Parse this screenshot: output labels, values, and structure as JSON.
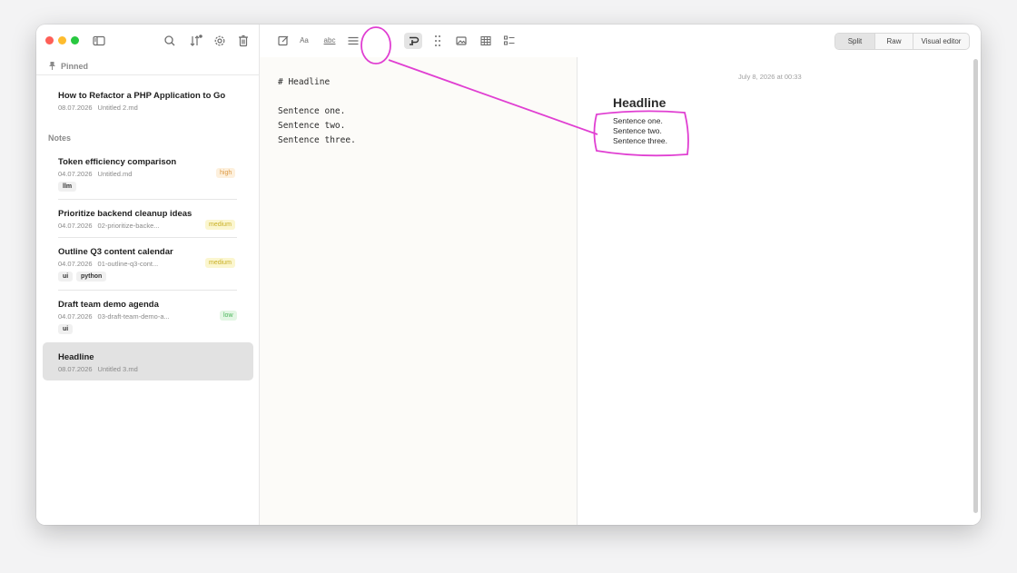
{
  "window": {
    "title": ""
  },
  "sidebar": {
    "pinned_label": "Pinned",
    "notes_label": "Notes",
    "pinned": [
      {
        "title": "How to Refactor a PHP Application to Go",
        "date": "08.07.2026",
        "file": "Untitled 2.md"
      }
    ],
    "notes": [
      {
        "title": "Token efficiency comparison",
        "date": "04.07.2026",
        "file": "Untitled.md",
        "priority": "high",
        "tags": [
          "llm"
        ]
      },
      {
        "title": "Prioritize backend cleanup ideas",
        "date": "04.07.2026",
        "file": "02-prioritize-backe...",
        "priority": "medium",
        "tags": []
      },
      {
        "title": "Outline Q3 content calendar",
        "date": "04.07.2026",
        "file": "01-outline-q3-cont...",
        "priority": "medium",
        "tags": [
          "ui",
          "python"
        ]
      },
      {
        "title": "Draft team demo agenda",
        "date": "04.07.2026",
        "file": "03-draft-team-demo-a...",
        "priority": "low",
        "tags": [
          "ui"
        ]
      },
      {
        "title": "Headline",
        "date": "08.07.2026",
        "file": "Untitled 3.md",
        "priority": "",
        "tags": [],
        "selected": true
      }
    ]
  },
  "toolbar": {
    "icons": [
      "new-note-icon",
      "font-icon",
      "spellcheck-icon",
      "list-icon",
      "format-paragraph-icon",
      "drag-handle-icon",
      "image-icon",
      "table-icon",
      "checklist-icon"
    ],
    "font_label": "Aa",
    "spell_label": "abc",
    "view_modes": [
      "Split",
      "Raw",
      "Visual editor"
    ],
    "active_view": "Split"
  },
  "editor": {
    "lines": [
      "# Headline",
      "",
      "Sentence one.",
      "Sentence two.",
      "Sentence three."
    ]
  },
  "preview": {
    "date": "July 8, 2026 at 00:33",
    "heading": "Headline",
    "paragraphs": [
      "Sentence one.",
      "Sentence two.",
      "Sentence three."
    ]
  },
  "colors": {
    "annotation": "#e03fd2",
    "priority_high": "#dd9a45",
    "priority_medium": "#c8ae22",
    "priority_low": "#49b55a",
    "selected_row": "#e2e2e2"
  }
}
